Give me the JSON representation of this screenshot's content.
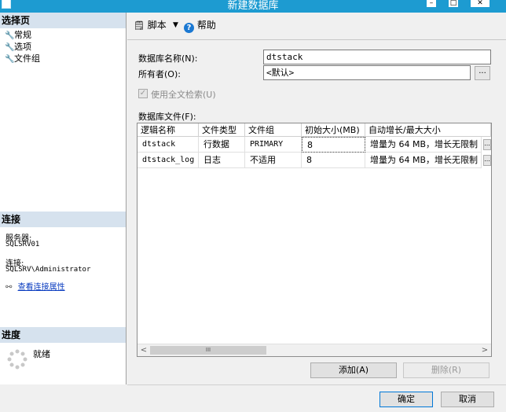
{
  "window": {
    "title": "新建数据库",
    "controls": [
      "minimize-icon",
      "maximize-icon",
      "close-icon"
    ]
  },
  "left": {
    "select_page_header": "选择页",
    "pages": [
      {
        "label": "常规",
        "icon": "wrench-icon"
      },
      {
        "label": "选项",
        "icon": "wrench-icon"
      },
      {
        "label": "文件组",
        "icon": "wrench-icon"
      }
    ],
    "connection_header": "连接",
    "server_label": "服务器:",
    "server_value": "SQLSRV01",
    "connection_label": "连接:",
    "connection_value": "SQLSRV\\Administrator",
    "view_props_link": "查看连接属性",
    "progress_header": "进度",
    "progress_status": "就绪"
  },
  "toolbar": {
    "script_label": "脚本",
    "help_label": "帮助"
  },
  "form": {
    "db_name_label": "数据库名称(N):",
    "db_name_value": "dtstack",
    "owner_label": "所有者(O):",
    "owner_value": "<默认>",
    "browse_label": "...",
    "fulltext_label": "使用全文检索(U)",
    "fulltext_checked": true,
    "db_files_label": "数据库文件(F):"
  },
  "grid": {
    "columns": [
      "逻辑名称",
      "文件类型",
      "文件组",
      "初始大小(MB)",
      "自动增长/最大大小"
    ],
    "rows": [
      [
        "dtstack",
        "行数据",
        "PRIMARY",
        "8",
        "增量为 64 MB，增长无限制"
      ],
      [
        "dtstack_log",
        "日志",
        "不适用",
        "8",
        "增量为 64 MB，增长无限制"
      ]
    ],
    "cell_button": "...",
    "scroll_left": "<",
    "scroll_right": ">",
    "scroll_thumb": "III"
  },
  "actions": {
    "add_label": "添加(A)",
    "remove_label": "删除(R)",
    "ok_label": "确定",
    "cancel_label": "取消"
  },
  "colors": {
    "titlebar": "#1d9bd1",
    "section_header": "#d6e2ee",
    "link": "#0a3cc0"
  }
}
